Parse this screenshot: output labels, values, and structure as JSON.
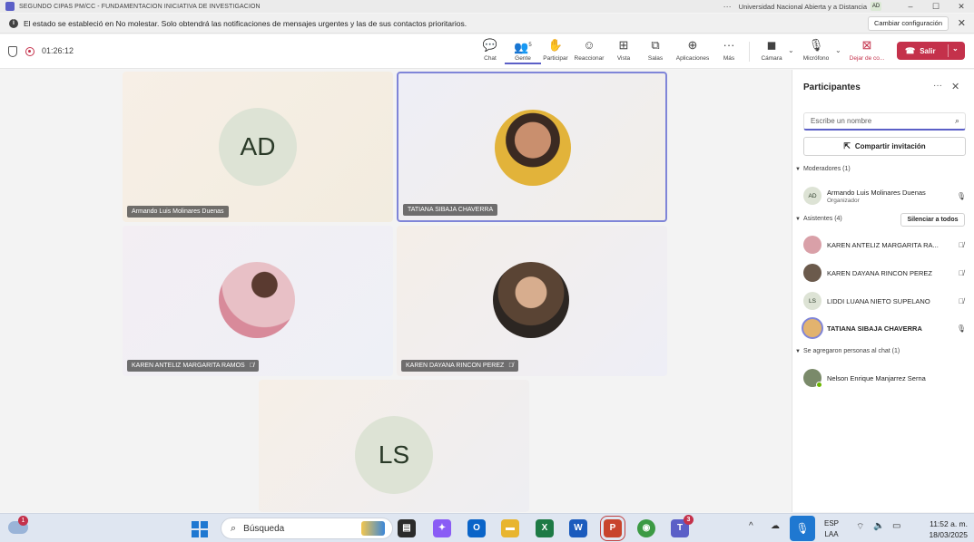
{
  "titlebar": {
    "title": "SEGUNDO CIPAS PM/CC - FUNDAMENTACION INICIATIVA DE INVESTIGACION",
    "more": "···",
    "organization": "Universidad Nacional Abierta y a Distancia",
    "account_initials": "AD",
    "minimize": "–",
    "maximize": "☐",
    "close": "✕"
  },
  "banner": {
    "message": "El estado se estableció en No molestar. Solo obtendrá las notificaciones de mensajes urgentes y las de sus contactos prioritarios.",
    "settings_button": "Cambiar configuración",
    "close": "✕"
  },
  "toolbar": {
    "timer": "01:26:12",
    "buttons": [
      {
        "label": "Chat",
        "icon": "chat-icon",
        "glyph": "💬"
      },
      {
        "label": "Gente",
        "icon": "people-icon",
        "glyph": "👥",
        "count": "5"
      },
      {
        "label": "Participar",
        "icon": "raise-hand-icon",
        "glyph": "✋"
      },
      {
        "label": "Reaccionar",
        "icon": "emoji-icon",
        "glyph": "☺"
      },
      {
        "label": "Vista",
        "icon": "grid-view-icon",
        "glyph": "⊞"
      },
      {
        "label": "Salas",
        "icon": "rooms-icon",
        "glyph": "⧉"
      },
      {
        "label": "Aplicaciones",
        "icon": "apps-icon",
        "glyph": "⊕"
      },
      {
        "label": "Más",
        "icon": "more-icon",
        "glyph": "···"
      },
      {
        "label": "Cámara",
        "icon": "camera-off-icon",
        "glyph": "◼"
      },
      {
        "label": "Micrófono",
        "icon": "microphone-icon",
        "glyph": "🎙"
      },
      {
        "label": "Dejar de co...",
        "icon": "stop-share-icon",
        "glyph": "⊠"
      }
    ],
    "leave_label": "Salir",
    "leave_icon": "phone-hangup-icon",
    "leave_color": "#c4314b"
  },
  "stage": {
    "tiles": [
      {
        "name": "Armando Luis Molinares Duenas",
        "initials": "AD",
        "muted": false
      },
      {
        "name": "TATIANA SIBAJA CHAVERRA",
        "photo": true,
        "muted": false,
        "speaking": true
      },
      {
        "name": "KAREN ANTELIZ MARGARITA RAMOS",
        "photo": true,
        "muted": true
      },
      {
        "name": "KAREN DAYANA RINCON PEREZ",
        "photo": true,
        "muted": true
      },
      {
        "name": "",
        "initials": "LS",
        "muted": false
      }
    ]
  },
  "panel": {
    "title": "Participantes",
    "more": "···",
    "close": "✕",
    "search_placeholder": "Escribe un nombre",
    "invite_label": "Compartir invitación",
    "moderators_header": "Moderadores (1)",
    "attendees_header": "Asistentes (4)",
    "mute_all_label": "Silenciar a todos",
    "chat_added_header": "Se agregaron personas al chat (1)",
    "moderators": [
      {
        "initials": "AD",
        "name": "Armando Luis Molinares Duenas",
        "role": "Organizador",
        "mic": "on"
      }
    ],
    "attendees": [
      {
        "initials": "",
        "name": "KAREN ANTELIZ MARGARITA RA...",
        "mic": "off",
        "avatar_color": "#d9a0a8"
      },
      {
        "initials": "",
        "name": "KAREN DAYANA RINCON PEREZ",
        "mic": "off",
        "avatar_color": "#6b5a4c"
      },
      {
        "initials": "LS",
        "name": "LIDDI LUANA NIETO SUPELANO",
        "mic": "off",
        "avatar_color": "#dde3d5"
      },
      {
        "initials": "",
        "name": "TATIANA SIBAJA CHAVERRA",
        "mic": "on",
        "avatar_color": "#e2b36e",
        "speaking": true
      }
    ],
    "chat_added": [
      {
        "initials": "",
        "name": "Nelson Enrique Manjarrez Serna",
        "avatar_color": "#7a8a6a"
      }
    ]
  },
  "taskbar": {
    "weather_badge": "1",
    "search_label": "Búsqueda",
    "apps": [
      {
        "name": "file-explorer-icon",
        "glyph": "▤",
        "color": "#f2b600"
      },
      {
        "name": "copilot-icon",
        "glyph": "✦",
        "color": "#8a5cf5"
      },
      {
        "name": "outlook-icon",
        "glyph": "O",
        "color": "#0a64c8"
      },
      {
        "name": "folder-icon",
        "glyph": "▬",
        "color": "#e8b52f"
      },
      {
        "name": "excel-icon",
        "glyph": "X",
        "color": "#1d7a45"
      },
      {
        "name": "word-icon",
        "glyph": "W",
        "color": "#1b5bbd"
      },
      {
        "name": "powerpoint-icon",
        "glyph": "P",
        "color": "#c8442c"
      },
      {
        "name": "chrome-icon",
        "glyph": "◉",
        "color": "#3c9a44"
      },
      {
        "name": "teams-icon",
        "glyph": "T",
        "color": "#5b5fc7",
        "badge": "3"
      }
    ],
    "lang_top": "ESP",
    "lang_bottom": "LAA",
    "time": "11:52 a. m.",
    "date": "18/03/2025"
  }
}
